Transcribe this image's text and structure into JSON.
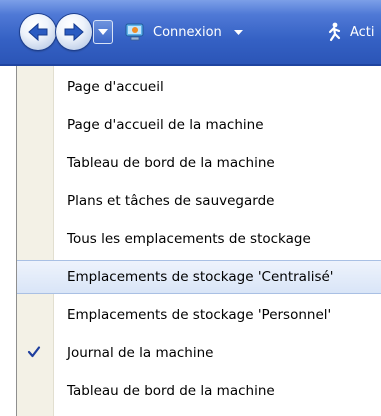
{
  "toolbar": {
    "connection_label": "Connexion",
    "actions_label": "Acti"
  },
  "menu": {
    "items": [
      {
        "label": "Page d'accueil",
        "checked": false
      },
      {
        "label": "Page d'accueil de la machine",
        "checked": false
      },
      {
        "label": "Tableau de bord de la machine",
        "checked": false
      },
      {
        "label": "Plans et tâches de sauvegarde",
        "checked": false
      },
      {
        "label": "Tous les emplacements de stockage",
        "checked": false
      },
      {
        "label": "Emplacements de stockage 'Centralisé'",
        "checked": false,
        "highlighted": true
      },
      {
        "label": "Emplacements de stockage 'Personnel'",
        "checked": false
      },
      {
        "label": "Journal de la machine",
        "checked": true
      },
      {
        "label": "Tableau de bord de la machine",
        "checked": false
      }
    ]
  },
  "icons": {
    "back": "arrow-left-icon",
    "forward": "arrow-right-icon",
    "dropdown": "chevron-down-icon",
    "connection": "computer-icon",
    "actions": "running-man-icon",
    "check": "check-icon"
  },
  "colors": {
    "toolbar": "#3561c4",
    "menu_gutter": "#f3f1e6",
    "highlight": "#d9e5f7",
    "check": "#1f3f9e"
  }
}
